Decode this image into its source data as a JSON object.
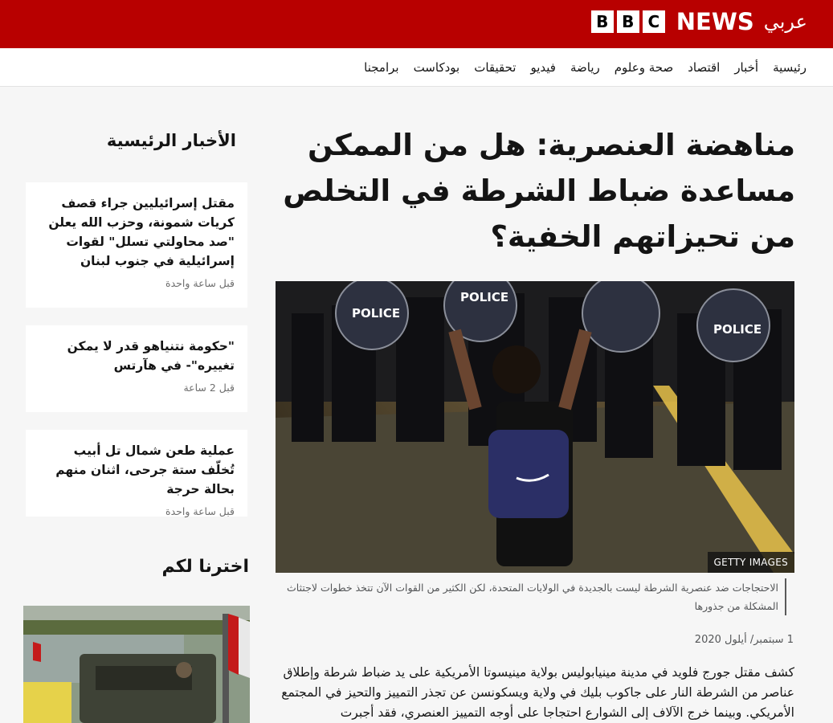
{
  "header": {
    "logo_blocks": [
      "B",
      "B",
      "C"
    ],
    "logo_news": "NEWS",
    "logo_arabic": "عربي",
    "brand_color": "#b80000"
  },
  "nav": {
    "items": [
      "رئيسية",
      "أخبار",
      "اقتصاد",
      "صحة وعلوم",
      "رياضة",
      "فيديو",
      "تحقيقات",
      "بودكاست",
      "برامجنا"
    ]
  },
  "article": {
    "headline": "مناهضة العنصرية: هل من الممكن مساعدة ضباط الشرطة في التخلص من تحيزاتهم الخفية؟",
    "image_credit": "GETTY IMAGES",
    "caption": "الاحتجاجات ضد عنصرية الشرطة ليست بالجديدة في الولايات المتحدة، لكن الكثير من القوات الآن تتخذ خطوات لاجتثاث المشكلة من جذورها",
    "date": "1 سبتمبر/ أيلول 2020",
    "body": "كشف مقتل جورج فلويد في مدينة مينيابوليس بولاية مينيسوتا الأمريكية على يد ضباط شرطة وإطلاق عناصر من الشرطة النار على جاكوب بليك في ولاية ويسكونسن عن تجذر التمييز والتحيز في المجتمع الأمريكي. وبينما خرج الآلاف إلى الشوارع احتجاجا على أوجه التمييز العنصري، فقد أجبرت",
    "shield_text": "POLICE"
  },
  "sidebar": {
    "title": "الأخبار الرئيسية",
    "stories": [
      {
        "headline": "مقتل إسرائيليين جراء قصف كريات شمونة، وحزب الله يعلن \"صد محاولتي تسلل\" لقوات إسرائيلية في جنوب لبنان",
        "time": "قبل ساعة واحدة"
      },
      {
        "headline": "\"حكومة نتنياهو قدر لا يمكن تغييره\"- في هآرتس",
        "time": "قبل 2 ساعة"
      },
      {
        "headline": "عملية طعن شمال تل أبيب تُخلّف ستة جرحى، اثنان منهم بحالة حرجة",
        "time": "قبل ساعة واحدة"
      }
    ],
    "picked_title": "اخترنا لكم"
  }
}
